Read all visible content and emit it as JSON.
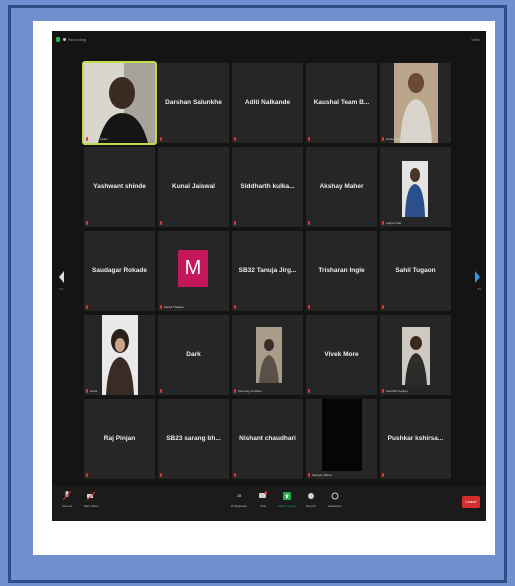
{
  "topbar": {
    "recording": "Recording",
    "view": "View"
  },
  "tiles": [
    {
      "name": "",
      "caption": "Sudhir Yadav"
    },
    {
      "name": "Darshan Salunkhe",
      "caption": ""
    },
    {
      "name": "Aditi Nalkande",
      "caption": ""
    },
    {
      "name": "Kaushal Team B...",
      "caption": ""
    },
    {
      "name": "",
      "caption": "Omkar Kalane"
    },
    {
      "name": "Yashwant shinde",
      "caption": ""
    },
    {
      "name": "Kunal Jaiswal",
      "caption": ""
    },
    {
      "name": "Siddharth kulka...",
      "caption": ""
    },
    {
      "name": "Akshay Maher",
      "caption": ""
    },
    {
      "name": "",
      "caption": "Aditya Patil"
    },
    {
      "name": "Saudagar Rokade",
      "caption": ""
    },
    {
      "name": "",
      "caption": "Mehul Thakare",
      "avatar_letter": "M"
    },
    {
      "name": "SB32 Tanuja Jirg...",
      "caption": ""
    },
    {
      "name": "Trisharan Ingle",
      "caption": ""
    },
    {
      "name": "Sahil Tugaon",
      "caption": ""
    },
    {
      "name": "",
      "caption": "Neha"
    },
    {
      "name": "Dark",
      "caption": ""
    },
    {
      "name": "",
      "caption": "Sarvang sonwane"
    },
    {
      "name": "Vivek More",
      "caption": ""
    },
    {
      "name": "",
      "caption": "Saurabh Kapure"
    },
    {
      "name": "Raj Pinjan",
      "caption": ""
    },
    {
      "name": "SB23 sarang bh...",
      "caption": ""
    },
    {
      "name": "Nishant chaudhari",
      "caption": ""
    },
    {
      "name": "",
      "caption": "Sanyam Bafna"
    },
    {
      "name": "Pushkar kshirsa...",
      "caption": ""
    }
  ],
  "pager": {
    "left": "1/3",
    "right": "3/3"
  },
  "toolbar": {
    "unmute": "Unmute",
    "start_video": "Start Video",
    "participants": "Participants",
    "participants_count": "28",
    "chat": "Chat",
    "share_screen": "Share Screen",
    "record": "Record",
    "reactions": "Reactions",
    "end": "Leave"
  },
  "colors": {
    "background": "#6f8fcf",
    "zoom_bg": "#141414",
    "tile": "#262626",
    "accent_green": "#21b04b",
    "end_red": "#d32f2f",
    "avatar_m": "#c2185b"
  }
}
